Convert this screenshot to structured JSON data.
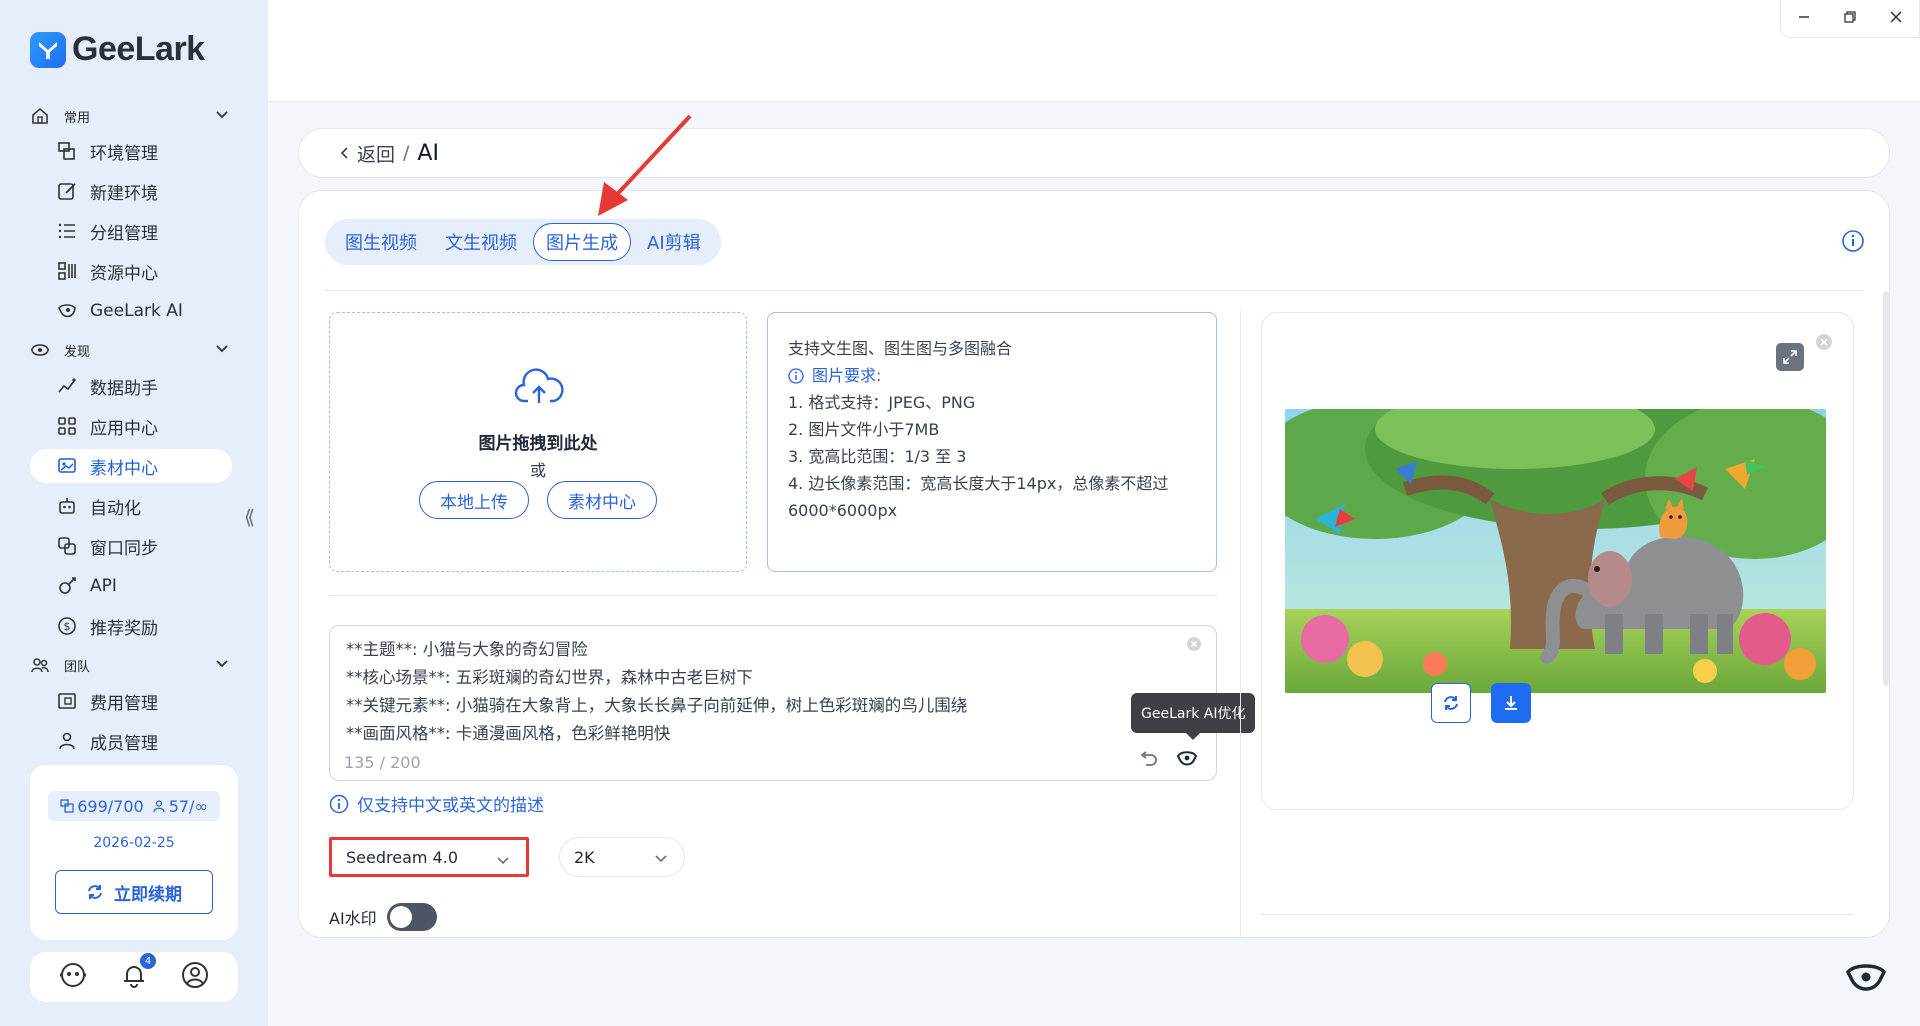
{
  "app": {
    "name": "GeeLark"
  },
  "sidebar": {
    "sections": [
      {
        "label": "常用",
        "icon": "home-icon"
      },
      {
        "label": "发现",
        "icon": "eye-icon"
      },
      {
        "label": "团队",
        "icon": "team-icon"
      }
    ],
    "items": [
      {
        "label": "环境管理",
        "icon": "environment-icon"
      },
      {
        "label": "新建环境",
        "icon": "edit-icon"
      },
      {
        "label": "分组管理",
        "icon": "list-icon"
      },
      {
        "label": "资源中心",
        "icon": "resource-icon"
      },
      {
        "label": "GeeLark AI",
        "icon": "geelark-ai-icon"
      },
      {
        "label": "数据助手",
        "icon": "data-icon"
      },
      {
        "label": "应用中心",
        "icon": "apps-icon"
      },
      {
        "label": "素材中心",
        "icon": "material-icon",
        "active": true
      },
      {
        "label": "自动化",
        "icon": "robot-icon"
      },
      {
        "label": "窗口同步",
        "icon": "sync-icon"
      },
      {
        "label": "API",
        "icon": "api-icon"
      },
      {
        "label": "推荐奖励",
        "icon": "dollar-icon"
      },
      {
        "label": "费用管理",
        "icon": "billing-icon"
      },
      {
        "label": "成员管理",
        "icon": "member-icon"
      }
    ],
    "plan": {
      "env_usage": "699/700",
      "member_usage": "57/∞",
      "expiry_date": "2026-02-25",
      "renew_label": "立即续期"
    },
    "notification_count": "4"
  },
  "breadcrumb": {
    "back_label": "返回",
    "separator": "/",
    "current": "AI"
  },
  "tabs": [
    {
      "label": "图生视频"
    },
    {
      "label": "文生视频"
    },
    {
      "label": "图片生成",
      "active": true
    },
    {
      "label": "AI剪辑"
    }
  ],
  "upload": {
    "title": "图片拖拽到此处",
    "or_text": "或",
    "local_upload_label": "本地上传",
    "material_center_label": "素材中心"
  },
  "requirements": {
    "intro": "支持文生图、图生图与多图融合",
    "heading": "图片要求:",
    "items": [
      "1. 格式支持：JPEG、PNG",
      "2. 图片文件小于7MB",
      "3. 宽高比范围：1/3 至 3",
      "4. 边长像素范围：宽高长度大于14px，总像素不超过",
      "6000*6000px"
    ]
  },
  "prompt": {
    "lines": [
      "**主题**: 小猫与大象的奇幻冒险",
      "**核心场景**: 五彩斑斓的奇幻世界，森林中古老巨树下",
      "**关键元素**: 小猫骑在大象背上，大象长长鼻子向前延伸，树上色彩斑斓的鸟儿围绕",
      "**画面风格**: 卡通漫画风格，色彩鲜艳明快"
    ],
    "counter": "135 / 200",
    "tooltip": "GeeLark AI优化"
  },
  "hint": "仅支持中文或英文的描述",
  "model_select": {
    "value": "Seedream 4.0"
  },
  "resolution_select": {
    "value": "2K"
  },
  "watermark": {
    "label": "AI水印",
    "enabled": false
  },
  "colors": {
    "primary": "#2b63d9",
    "sidebar_bg": "#e6eefb",
    "highlight": "#e53935"
  }
}
